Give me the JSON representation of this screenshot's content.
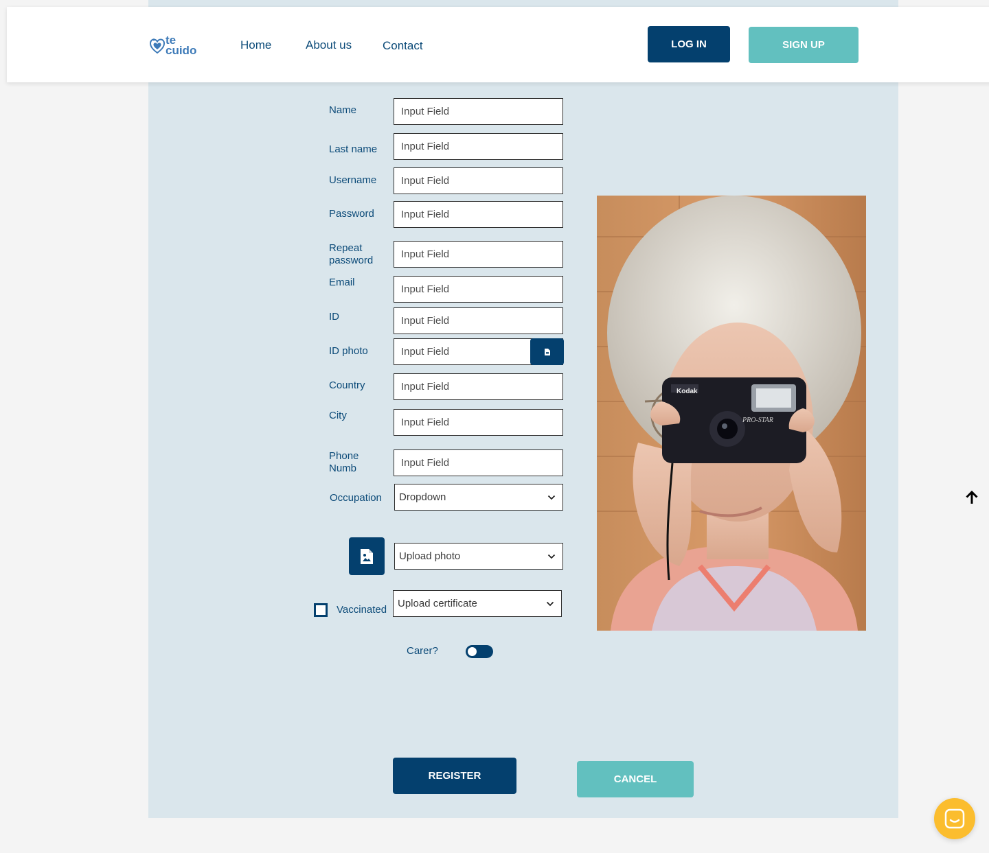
{
  "header": {
    "logo_line1": "te",
    "logo_line2": "cuido",
    "nav": {
      "home": "Home",
      "about": "About us",
      "contact": "Contact"
    },
    "login_label": "LOG IN",
    "signup_label": "SIGN UP"
  },
  "form": {
    "placeholder": "Input Field",
    "labels": {
      "name": "Name",
      "last_name": "Last name",
      "username": "Username",
      "password": "Password",
      "repeat_password_1": "Repeat",
      "repeat_password_2": "password",
      "email": "Email",
      "id": "ID",
      "id_photo": "ID photo",
      "country": "Country",
      "city": "City",
      "phone_1": "Phone",
      "phone_2": "Numb",
      "occupation": "Occupation",
      "vaccinated": "Vaccinated",
      "carer": "Carer?"
    },
    "occupation_value": "Dropdown",
    "upload_photo_value": "Upload photo",
    "upload_certificate_value": "Upload certificate",
    "vaccinated_checked": false,
    "carer_on": false
  },
  "actions": {
    "register_label": "REGISTER",
    "cancel_label": "CANCEL"
  },
  "icons": {
    "file": "file-icon",
    "image_file": "image-file-icon",
    "chevron": "chevron-down-icon",
    "back_to_top": "arrow-up-icon",
    "chat": "chat-icon"
  },
  "colors": {
    "primary": "#04406e",
    "accent": "#62c0bf",
    "panel": "#dae6ec",
    "chat": "#fbbd2e"
  }
}
